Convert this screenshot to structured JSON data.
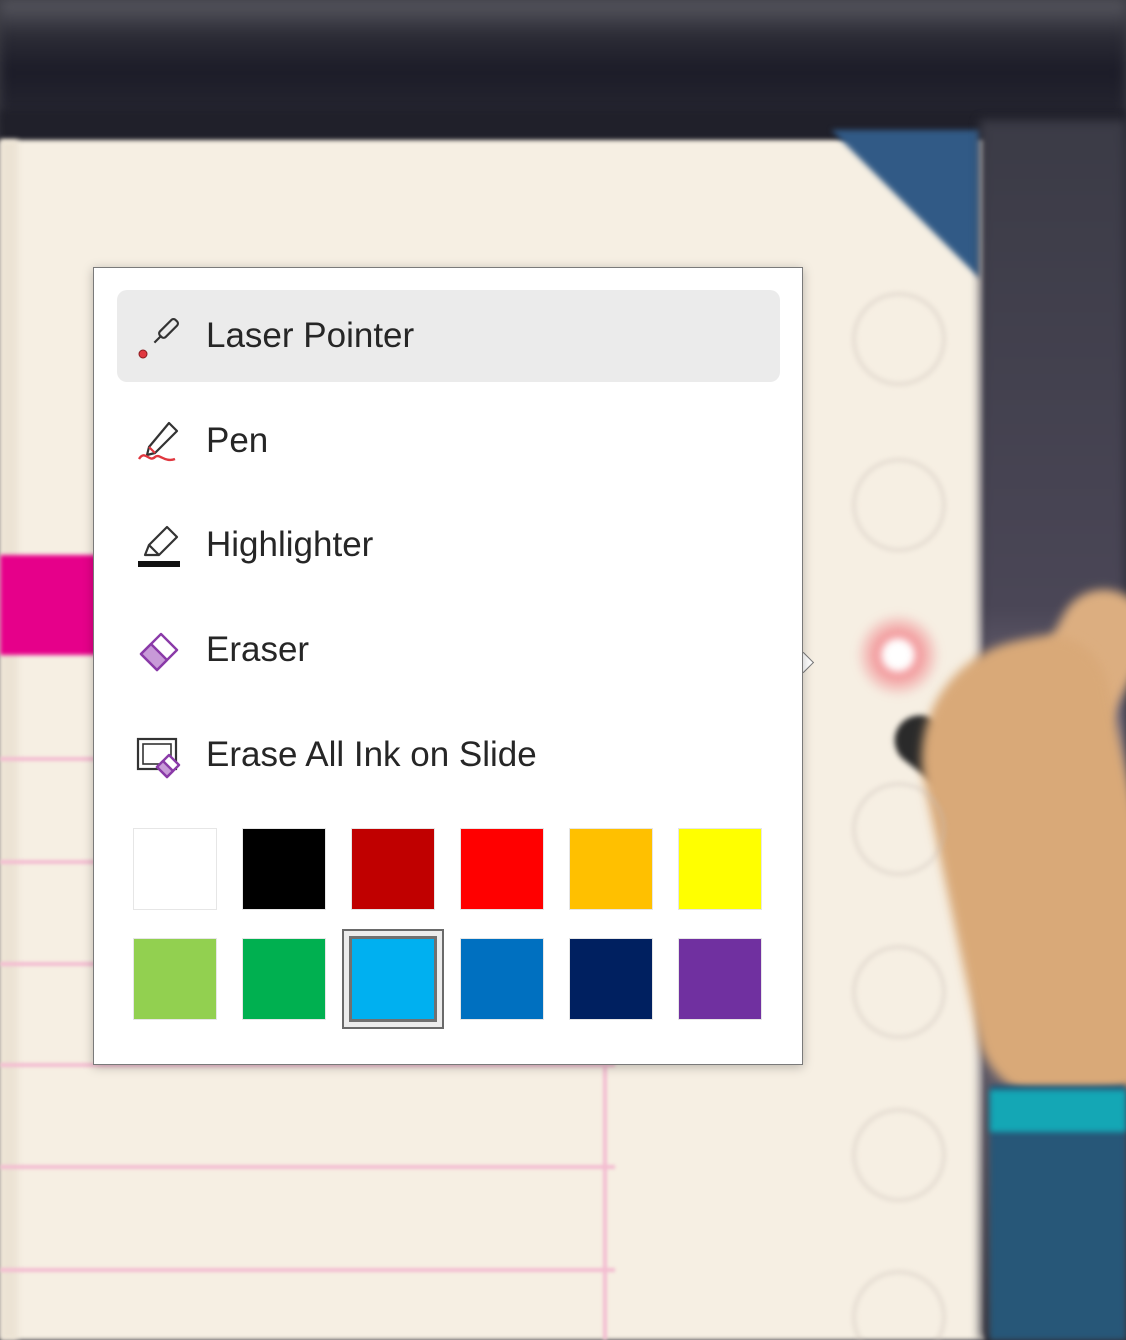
{
  "menu": {
    "items": [
      {
        "label": "Laser Pointer",
        "icon": "laser-pointer-icon",
        "selected": true
      },
      {
        "label": "Pen",
        "icon": "pen-icon",
        "selected": false
      },
      {
        "label": "Highlighter",
        "icon": "highlighter-icon",
        "selected": false
      },
      {
        "label": "Eraser",
        "icon": "eraser-icon",
        "selected": false
      },
      {
        "label": "Erase All Ink on Slide",
        "icon": "erase-all-ink-icon",
        "selected": false
      }
    ],
    "colors": {
      "row1": [
        "#FFFFFF",
        "#000000",
        "#C00000",
        "#FF0000",
        "#FFC000",
        "#FFFF00"
      ],
      "row2": [
        "#92D050",
        "#00B050",
        "#00B0F0",
        "#0070C0",
        "#002060",
        "#7030A0"
      ],
      "selected_color": "#00B0F0"
    }
  },
  "slide_controls": {
    "buttons": [
      "next-icon",
      "previous-icon",
      "pen-tools-icon",
      "see-all-slides-icon",
      "subtitles-icon",
      "more-options-icon"
    ]
  },
  "theme": {
    "accent_pink": "#E6008A",
    "slide_bg": "#F6EFE3",
    "corner_blue": "#315A86"
  }
}
